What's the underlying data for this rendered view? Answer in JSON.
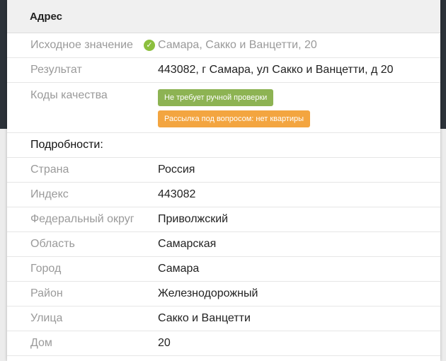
{
  "header": {
    "title": "Адрес"
  },
  "source": {
    "label": "Исходное значение",
    "value": "Самара, Сакко и Ванцетти, 20",
    "icon": "check-circle-icon"
  },
  "result": {
    "label": "Результат",
    "value": "443082, г Самара, ул Сакко и Ванцетти, д 20"
  },
  "quality": {
    "label": "Коды качества",
    "badges": [
      {
        "text": "Не требует ручной проверки",
        "color": "#8db353"
      },
      {
        "text": "Рассылка под вопросом: нет квартиры",
        "color": "#f3a540"
      }
    ]
  },
  "details": {
    "title": "Подробности:",
    "rows": [
      {
        "label": "Страна",
        "value": "Россия"
      },
      {
        "label": "Индекс",
        "value": "443082"
      },
      {
        "label": "Федеральный округ",
        "value": "Приволжский"
      },
      {
        "label": "Область",
        "value": "Самарская"
      },
      {
        "label": "Город",
        "value": "Самара"
      },
      {
        "label": "Район",
        "value": "Железнодорожный"
      },
      {
        "label": "Улица",
        "value": "Сакко и Ванцетти"
      },
      {
        "label": "Дом",
        "value": "20"
      }
    ]
  }
}
